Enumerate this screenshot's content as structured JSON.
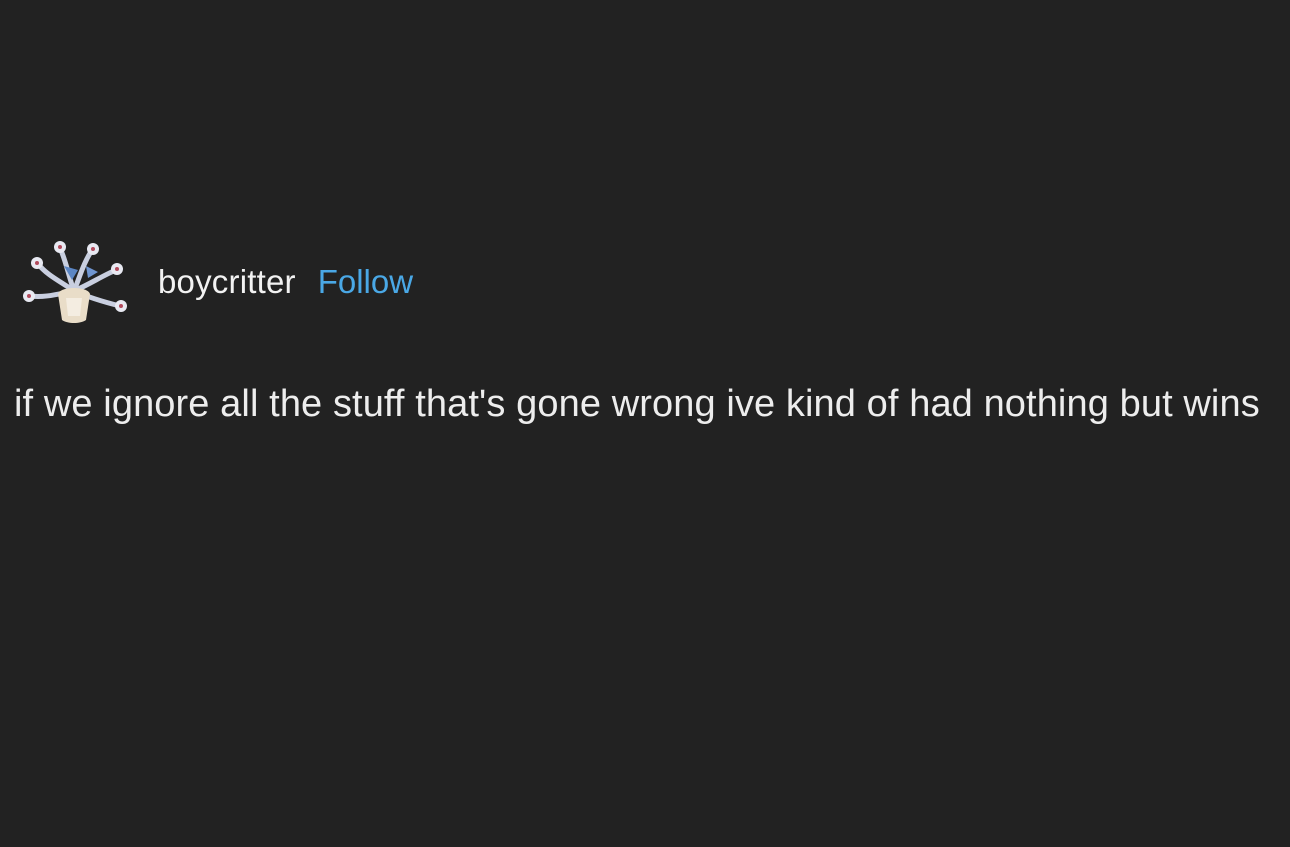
{
  "post": {
    "username": "boycritter",
    "follow_label": "Follow",
    "body_text": "if we ignore all the stuff that's gone wrong ive kind of had nothing but wins",
    "avatar_icon": "sea-creature-avatar-icon"
  },
  "colors": {
    "background": "#222222",
    "text": "#ededed",
    "follow_link": "#4aa8e6"
  }
}
